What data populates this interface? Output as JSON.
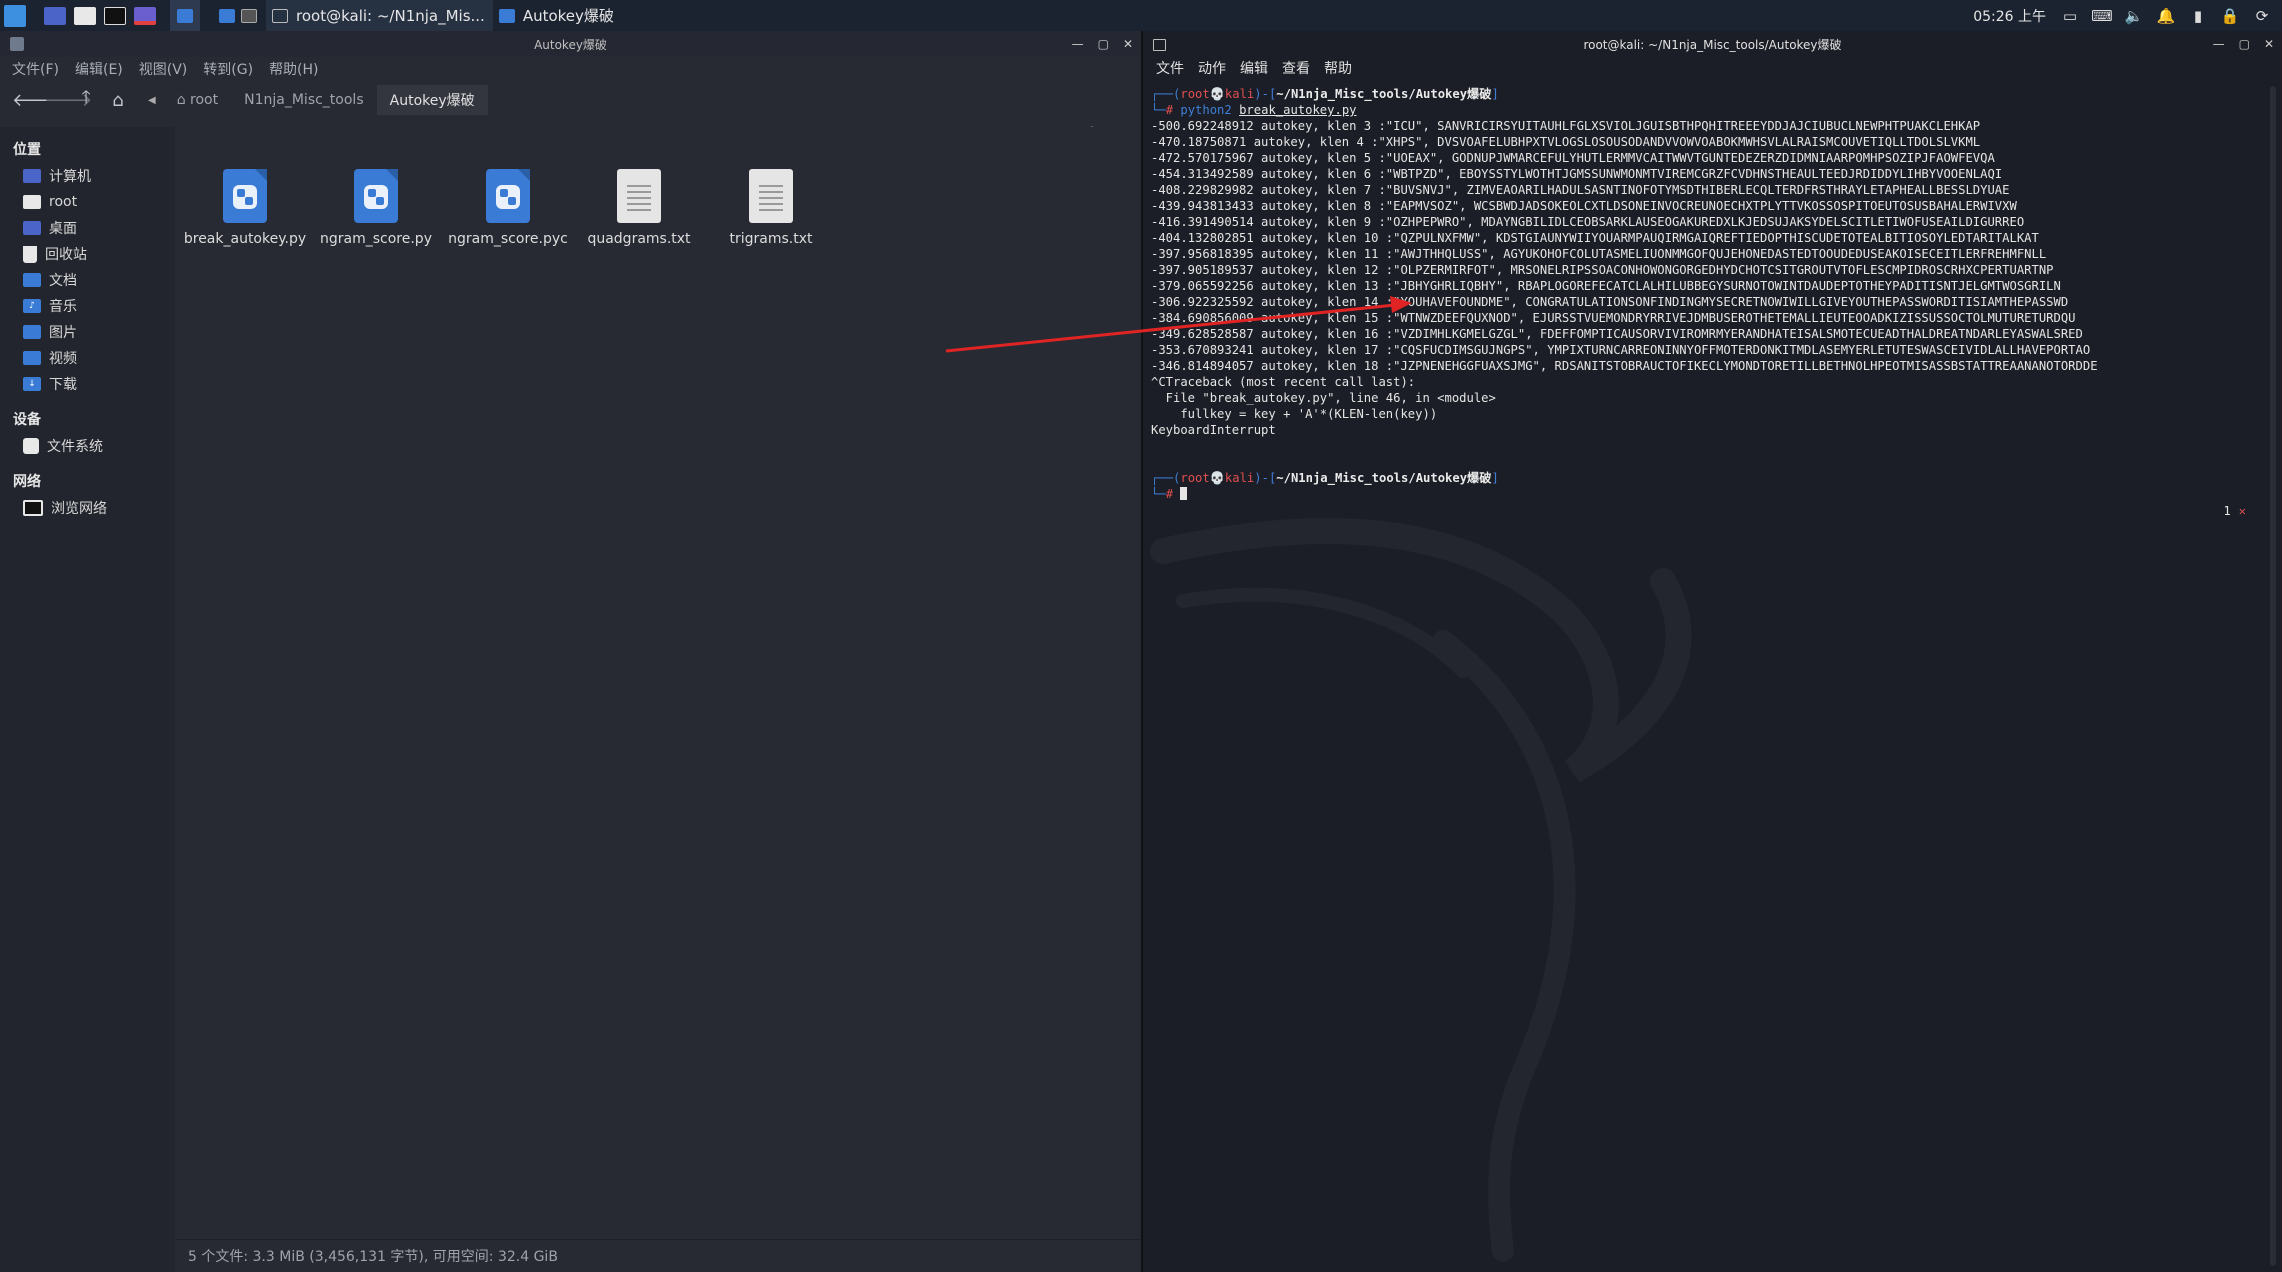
{
  "panel": {
    "tasks": [
      {
        "label": "root@kali: ~/N1nja_Mis..."
      },
      {
        "label": "Autokey爆破"
      }
    ],
    "clock": "05:26 上午"
  },
  "file_manager": {
    "title": "Autokey爆破",
    "menu": [
      "文件(F)",
      "编辑(E)",
      "视图(V)",
      "转到(G)",
      "帮助(H)"
    ],
    "breadcrumb": [
      "root",
      "N1nja_Misc_tools",
      "Autokey爆破"
    ],
    "sidebar": {
      "places_header": "位置",
      "places": [
        "计算机",
        "root",
        "桌面",
        "回收站",
        "文档",
        "音乐",
        "图片",
        "视频",
        "下载"
      ],
      "devices_header": "设备",
      "devices": [
        "文件系统"
      ],
      "network_header": "网络",
      "network": [
        "浏览网络"
      ]
    },
    "files": [
      {
        "name": "break_autokey.py",
        "icon": "python-file-icon"
      },
      {
        "name": "ngram_score.py",
        "icon": "python-file-icon"
      },
      {
        "name": "ngram_score.pyc",
        "icon": "python-file-icon"
      },
      {
        "name": "quadgrams.txt",
        "icon": "text-file-icon"
      },
      {
        "name": "trigrams.txt",
        "icon": "text-file-icon"
      }
    ],
    "status": "5 个文件: 3.3 MiB (3,456,131 字节), 可用空间: 32.4 GiB"
  },
  "terminal": {
    "title": "root@kali: ~/N1nja_Misc_tools/Autokey爆破",
    "menu": [
      "文件",
      "动作",
      "编辑",
      "查看",
      "帮助"
    ],
    "prompt_user": "root",
    "prompt_host": "kali",
    "prompt_dir": "~/N1nja_Misc_tools/Autokey爆破",
    "command_prog": "python2",
    "command_arg": "break_autokey.py",
    "output": [
      "-500.692248912 autokey, klen 3 :\"ICU\", SANVRICIRSYUITAUHLFGLXSVIOLJGUISBTHPQHITREEEYDDJAJCIUBUCLNEWPHTPUAKCLEHKAP",
      "-470.18750871 autokey, klen 4 :\"XHPS\", DVSVOAFELUBHPXTVLOGSLOSOUSODANDVVOWVOABOKMWHSVLALRAISMCOUVETIQLLTDOLSLVKML",
      "-472.570175967 autokey, klen 5 :\"UOEAX\", GODNUPJWMARCEFULYHUTLERMMVCAITWWVTGUNTEDEZERZDIDMNIAARPOMHPSOZIPJFAOWFEVQA",
      "-454.313492589 autokey, klen 6 :\"WBTPZD\", EBOYSSTYLWOTHTJGMSSUNWMONMTVIREMCGRZFCVDHNSTHEAULTEEDJRDIDDYLIHBYVOOENLAQI",
      "-408.229829982 autokey, klen 7 :\"BUVSNVJ\", ZIMVEAOARILHADULSASNTINOFOTYMSDTHIBERLECQLTERDFRSTHRAYLETAPHEALLBESSLDYUAE",
      "-439.943813433 autokey, klen 8 :\"EAPMVSOZ\", WCSBWDJADSOKEOLCXTLDSONEINVOCREUNOECHXTPLYTTVKOSSOSPITOEUTOSUSBAHALERWIVXW",
      "-416.391490514 autokey, klen 9 :\"OZHPEPWRO\", MDAYNGBILIDLCEOBSARKLAUSEOGAKUREDXLKJEDSUJAKSYDELSCITLETIWOFUSEAILDIGURREO",
      "-404.132802851 autokey, klen 10 :\"QZPULNXFMW\", KDSTGIAUNYWIIYOUARMPAUQIRMGAIQREFTIEDOPTHISCUDETOTEALBITIOSOYLEDTARITALKAT",
      "-397.956818395 autokey, klen 11 :\"AWJTHHQLUSS\", AGYUKOHOFCOLUTASMELIUONMMGOFQUJEHONEDASTEDTOOUDEDUSEAKOISECEITLERFREHMFNLL",
      "-397.905189537 autokey, klen 12 :\"OLPZERMIRFOT\", MRSONELRIPSSOACONHOWONGORGEDHYDCHOTCSITGROUTVTOFLESCMPIDROSCRHXCPERTUARTNP",
      "-379.065592256 autokey, klen 13 :\"JBHYGHRLIQBHY\", RBAPLOGOREFECATCLALHILUBBEGYSURNOTOWINTDAUDEPTOTHEYPADITISNTJELGMTWOSGRILN",
      "-306.922325592 autokey, klen 14 :\"YOUHAVEFOUNDME\", CONGRATULATIONSONFINDINGMYSECRETNOWIWILLGIVEYOUTHEPASSWORDITISIAMTHEPASSWD",
      "-384.690856009 autokey, klen 15 :\"WTNWZDEEFQUXNOD\", EJURSSTVUEMONDRYRRIVEJDMBUSEROTHETEMALLIEUTEOOADKIZISSUSSOCTOLMUTURETURDQU",
      "-349.628528587 autokey, klen 16 :\"VZDIMHLKGMELGZGL\", FDEFFOMPTICAUSORVIVIROMRMYERANDHATEISALSMOTECUEADTHALDREATNDARLEYASWALSRED",
      "-353.670893241 autokey, klen 17 :\"CQSFUCDIMSGUJNGPS\", YMPIXTURNCARREONINNYOFFMOTERDONKITMDLASEMYERLETUTESWASCEIVIDLALLHAVEPORTAO",
      "-346.814894057 autokey, klen 18 :\"JZPNENEHGGFUAXSJMG\", RDSANITSTOBRAUCTOFIKECLYMONDTORETILLBETHNOLHPEOTMISASSBSTATTREAANANOTORDDE",
      "^CTraceback (most recent call last):",
      "  File \"break_autokey.py\", line 46, in <module>",
      "    fullkey = key + 'A'*(KLEN-len(key))",
      "KeyboardInterrupt"
    ],
    "right_status": "1",
    "right_status_mark": "✕"
  }
}
